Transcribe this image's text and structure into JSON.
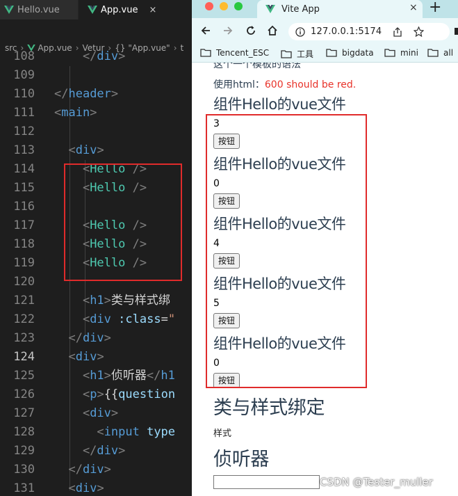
{
  "editor": {
    "tabs": [
      {
        "label": "Hello.vue",
        "active": false
      },
      {
        "label": "App.vue",
        "active": true,
        "close": "×"
      }
    ],
    "breadcrumb": [
      "src",
      "App.vue",
      "Vetur",
      "{} \"App.vue\"",
      "t"
    ],
    "lines": [
      {
        "num": "108",
        "parts": [
          [
            "t-bracket",
            "    </"
          ],
          [
            "t-tag",
            "div"
          ],
          [
            "t-bracket",
            ">"
          ]
        ]
      },
      {
        "num": "109",
        "parts": []
      },
      {
        "num": "110",
        "parts": [
          [
            "t-bracket",
            "</"
          ],
          [
            "t-tag",
            "header"
          ],
          [
            "t-bracket",
            ">"
          ]
        ]
      },
      {
        "num": "111",
        "parts": [
          [
            "t-bracket",
            "<"
          ],
          [
            "t-tag",
            "main"
          ],
          [
            "t-bracket",
            ">"
          ]
        ]
      },
      {
        "num": "112",
        "parts": []
      },
      {
        "num": "113",
        "parts": [
          [
            "t-bracket",
            "  <"
          ],
          [
            "t-tag",
            "div"
          ],
          [
            "t-bracket",
            ">"
          ]
        ]
      },
      {
        "num": "114",
        "parts": [
          [
            "t-bracket",
            "    <"
          ],
          [
            "t-comp",
            "Hello"
          ],
          [
            "t-bracket",
            " />"
          ]
        ]
      },
      {
        "num": "115",
        "parts": [
          [
            "t-bracket",
            "    <"
          ],
          [
            "t-comp",
            "Hello"
          ],
          [
            "t-bracket",
            " />"
          ]
        ]
      },
      {
        "num": "116",
        "parts": []
      },
      {
        "num": "117",
        "parts": [
          [
            "t-bracket",
            "    <"
          ],
          [
            "t-comp",
            "Hello"
          ],
          [
            "t-bracket",
            " />"
          ]
        ]
      },
      {
        "num": "118",
        "parts": [
          [
            "t-bracket",
            "    <"
          ],
          [
            "t-comp",
            "Hello"
          ],
          [
            "t-bracket",
            " />"
          ]
        ]
      },
      {
        "num": "119",
        "parts": [
          [
            "t-bracket",
            "    <"
          ],
          [
            "t-comp",
            "Hello"
          ],
          [
            "t-bracket",
            " />"
          ]
        ]
      },
      {
        "num": "120",
        "parts": []
      },
      {
        "num": "121",
        "parts": [
          [
            "t-bracket",
            "    <"
          ],
          [
            "t-tag",
            "h1"
          ],
          [
            "t-bracket",
            ">"
          ],
          [
            "t-text",
            "类与样式绑"
          ]
        ]
      },
      {
        "num": "122",
        "parts": [
          [
            "t-bracket",
            "    <"
          ],
          [
            "t-tag",
            "div"
          ],
          [
            "t-attr",
            " :class"
          ],
          [
            "t-text",
            "="
          ],
          [
            "t-str",
            "\""
          ]
        ]
      },
      {
        "num": "123",
        "parts": [
          [
            "t-bracket",
            "  </"
          ],
          [
            "t-tag",
            "div"
          ],
          [
            "t-bracket",
            ">"
          ]
        ]
      },
      {
        "num": "124",
        "parts": [
          [
            "t-bracket",
            "  <"
          ],
          [
            "t-tag",
            "div"
          ],
          [
            "t-bracket",
            ">"
          ]
        ],
        "current": true
      },
      {
        "num": "125",
        "parts": [
          [
            "t-bracket",
            "    <"
          ],
          [
            "t-tag",
            "h1"
          ],
          [
            "t-bracket",
            ">"
          ],
          [
            "t-text",
            "侦听器"
          ],
          [
            "t-bracket",
            "</"
          ],
          [
            "t-tag",
            "h1"
          ]
        ]
      },
      {
        "num": "126",
        "parts": [
          [
            "t-bracket",
            "    <"
          ],
          [
            "t-tag",
            "p"
          ],
          [
            "t-bracket",
            ">"
          ],
          [
            "t-text",
            "{{"
          ],
          [
            "t-attr",
            "question"
          ]
        ]
      },
      {
        "num": "127",
        "parts": [
          [
            "t-bracket",
            "    <"
          ],
          [
            "t-tag",
            "div"
          ],
          [
            "t-bracket",
            ">"
          ]
        ]
      },
      {
        "num": "128",
        "parts": [
          [
            "t-bracket",
            "      <"
          ],
          [
            "t-tag",
            "input"
          ],
          [
            "t-attr",
            " type"
          ]
        ]
      },
      {
        "num": "129",
        "parts": [
          [
            "t-bracket",
            "    </"
          ],
          [
            "t-tag",
            "div"
          ],
          [
            "t-bracket",
            ">"
          ]
        ]
      },
      {
        "num": "130",
        "parts": [
          [
            "t-bracket",
            "  </"
          ],
          [
            "t-tag",
            "div"
          ],
          [
            "t-bracket",
            ">"
          ]
        ]
      },
      {
        "num": "131",
        "parts": [
          [
            "t-bracket",
            "  <"
          ],
          [
            "t-tag",
            "div"
          ],
          [
            "t-bracket",
            ">"
          ]
        ]
      }
    ]
  },
  "browser": {
    "tab_title": "Vite App",
    "tab_close": "×",
    "new_tab": "+",
    "url": "127.0.0.1:5174",
    "bookmarks": [
      "Tencent_ESC",
      "工具",
      "bigdata",
      "mini",
      "all"
    ],
    "colors": {
      "accent_red": "#e02b2b",
      "error_text": "#e8332a",
      "title_text": "#2c3e50"
    }
  },
  "page": {
    "cut_line": "这个一个模板的语法",
    "html_label": "使用html：",
    "html_red": "600 should be red.",
    "components": [
      {
        "title": "组件Hello的vue文件",
        "count": "3",
        "button": "按钮"
      },
      {
        "title": "组件Hello的vue文件",
        "count": "0",
        "button": "按钮"
      },
      {
        "title": "组件Hello的vue文件",
        "count": "4",
        "button": "按钮"
      },
      {
        "title": "组件Hello的vue文件",
        "count": "5",
        "button": "按钮"
      },
      {
        "title": "组件Hello的vue文件",
        "count": "0",
        "button": "按钮"
      }
    ],
    "class_title": "类与样式绑定",
    "style_text": "样式",
    "watcher_title": "侦听器",
    "watermark": "CSDN @Tester_muller"
  }
}
